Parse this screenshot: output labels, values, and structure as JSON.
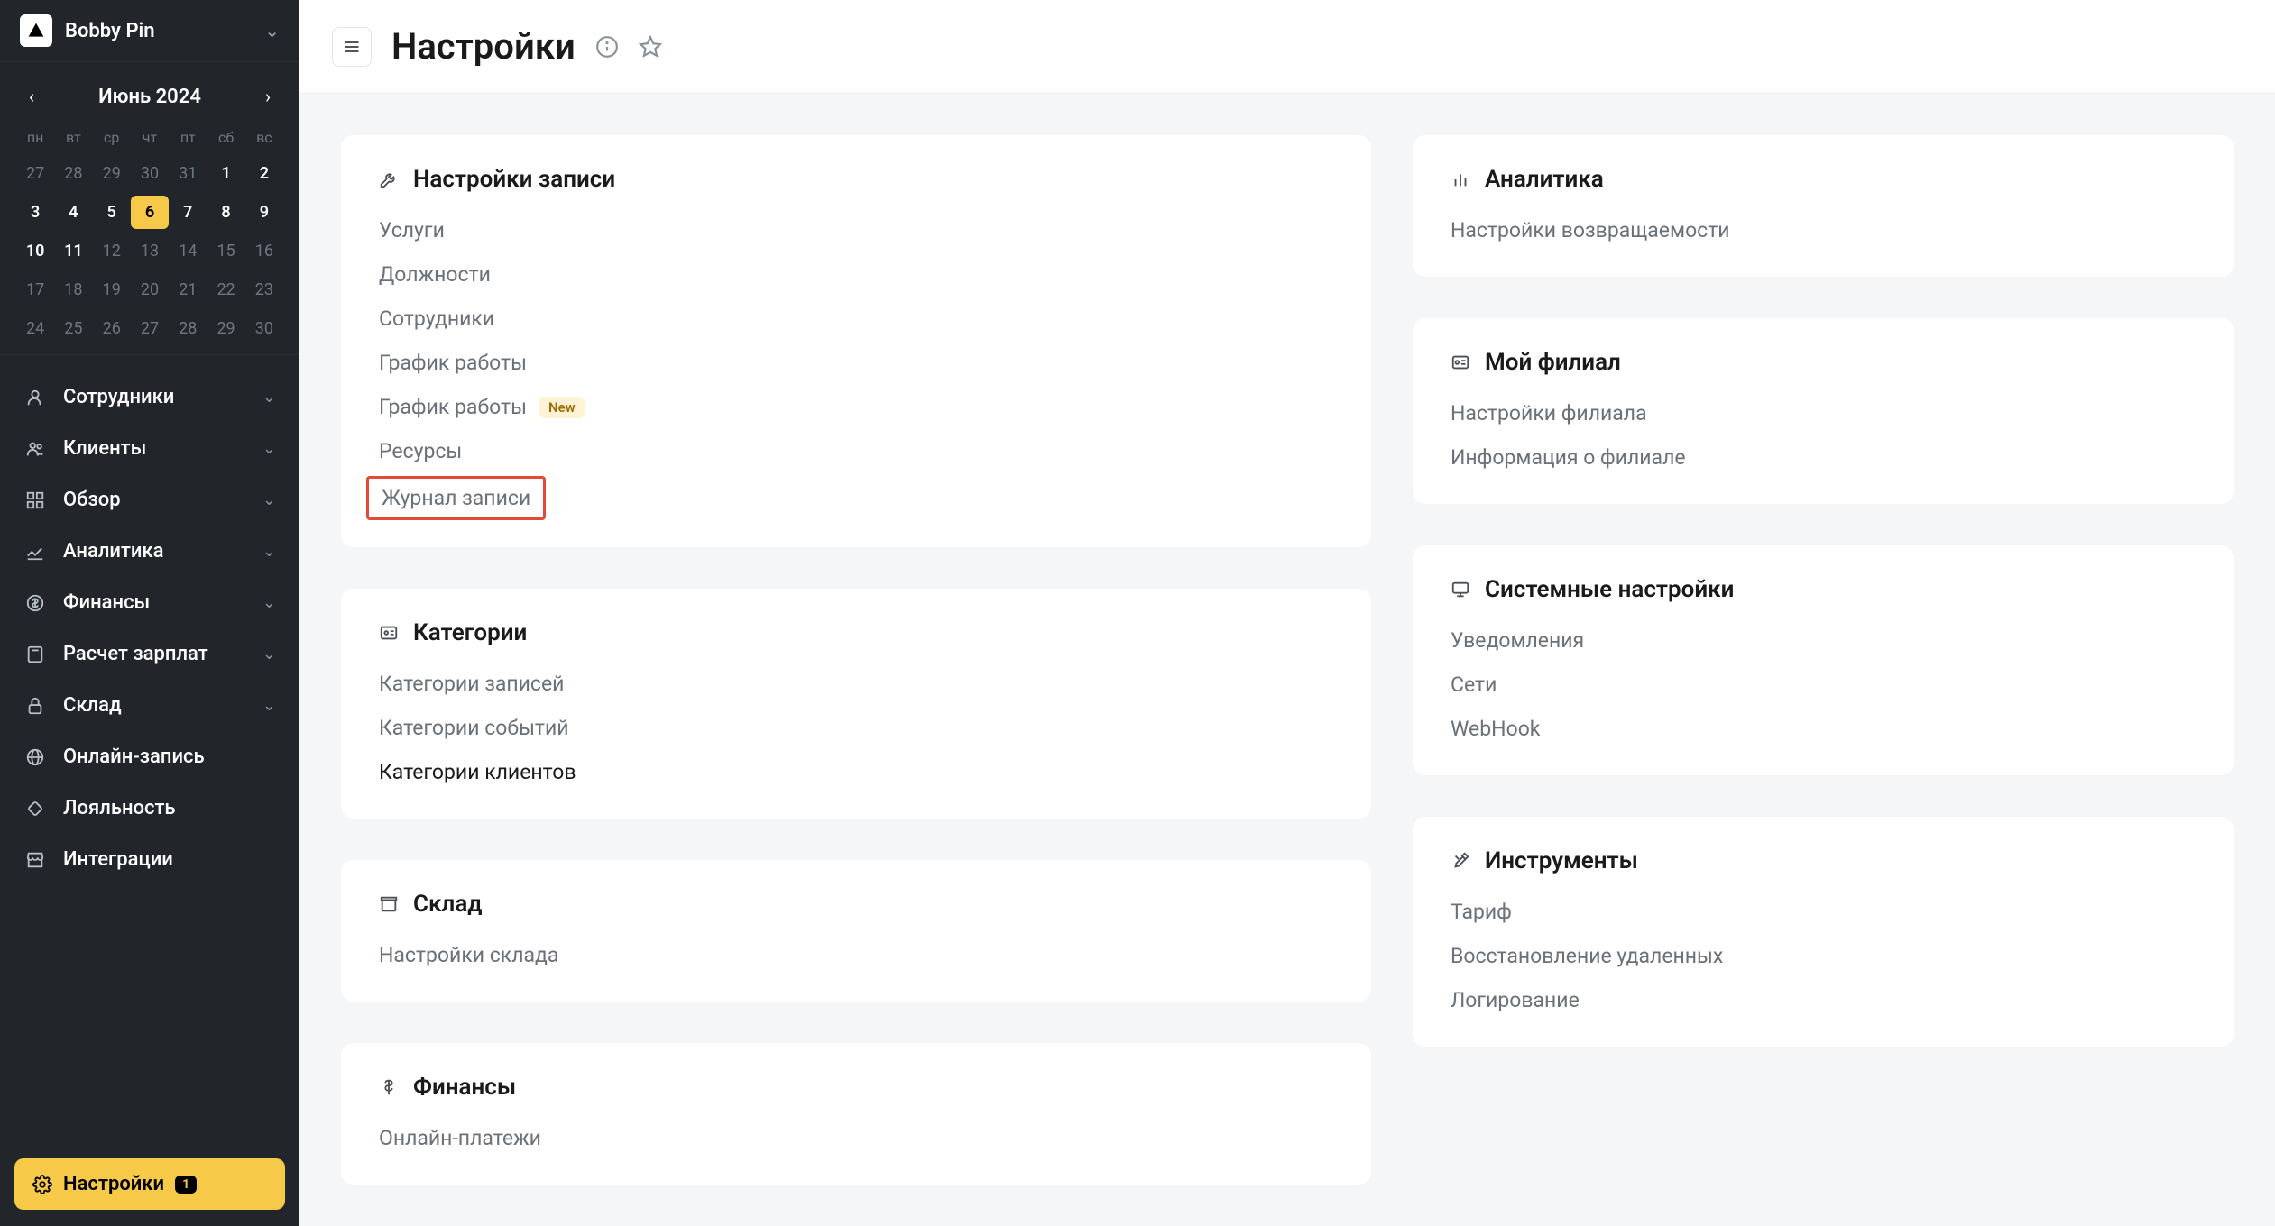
{
  "brand": "Bobby Pin",
  "calendar": {
    "title": "Июнь 2024",
    "dow": [
      "пн",
      "вт",
      "ср",
      "чт",
      "пт",
      "сб",
      "вс"
    ],
    "weeks": [
      [
        {
          "d": "27"
        },
        {
          "d": "28"
        },
        {
          "d": "29"
        },
        {
          "d": "30"
        },
        {
          "d": "31"
        },
        {
          "d": "1",
          "bold": true
        },
        {
          "d": "2",
          "bold": true
        }
      ],
      [
        {
          "d": "3",
          "bold": true
        },
        {
          "d": "4",
          "bold": true
        },
        {
          "d": "5",
          "bold": true
        },
        {
          "d": "6",
          "today": true
        },
        {
          "d": "7",
          "bold": true
        },
        {
          "d": "8",
          "bold": true
        },
        {
          "d": "9",
          "bold": true
        }
      ],
      [
        {
          "d": "10",
          "bold": true
        },
        {
          "d": "11",
          "bold": true
        },
        {
          "d": "12"
        },
        {
          "d": "13"
        },
        {
          "d": "14"
        },
        {
          "d": "15"
        },
        {
          "d": "16"
        }
      ],
      [
        {
          "d": "17"
        },
        {
          "d": "18"
        },
        {
          "d": "19"
        },
        {
          "d": "20"
        },
        {
          "d": "21"
        },
        {
          "d": "22"
        },
        {
          "d": "23"
        }
      ],
      [
        {
          "d": "24"
        },
        {
          "d": "25"
        },
        {
          "d": "26"
        },
        {
          "d": "27"
        },
        {
          "d": "28"
        },
        {
          "d": "29"
        },
        {
          "d": "30"
        }
      ]
    ]
  },
  "nav": [
    {
      "label": "Сотрудники",
      "expandable": true,
      "icon": "user"
    },
    {
      "label": "Клиенты",
      "expandable": true,
      "icon": "users"
    },
    {
      "label": "Обзор",
      "expandable": true,
      "icon": "grid"
    },
    {
      "label": "Аналитика",
      "expandable": true,
      "icon": "chart"
    },
    {
      "label": "Финансы",
      "expandable": true,
      "icon": "dollar"
    },
    {
      "label": "Расчет зарплат",
      "expandable": true,
      "icon": "calc"
    },
    {
      "label": "Склад",
      "expandable": true,
      "icon": "lock"
    },
    {
      "label": "Онлайн-запись",
      "expandable": false,
      "icon": "globe"
    },
    {
      "label": "Лояльность",
      "expandable": false,
      "icon": "diamond"
    },
    {
      "label": "Интеграции",
      "expandable": false,
      "icon": "shop"
    }
  ],
  "settings_btn": {
    "label": "Настройки",
    "badge": "1"
  },
  "page": {
    "title": "Настройки"
  },
  "cards_left": [
    {
      "icon": "wrench",
      "title": "Настройки записи",
      "links": [
        {
          "t": "Услуги"
        },
        {
          "t": "Должности"
        },
        {
          "t": "Сотрудники"
        },
        {
          "t": "График работы"
        },
        {
          "t": "График работы",
          "new": true
        },
        {
          "t": "Ресурсы"
        },
        {
          "t": "Журнал записи",
          "hl": true
        }
      ]
    },
    {
      "icon": "card",
      "title": "Категории",
      "links": [
        {
          "t": "Категории записей"
        },
        {
          "t": "Категории событий"
        },
        {
          "t": "Категории клиентов",
          "dark": true
        }
      ]
    },
    {
      "icon": "box",
      "title": "Склад",
      "links": [
        {
          "t": "Настройки склада"
        }
      ]
    },
    {
      "icon": "dollar",
      "title": "Финансы",
      "links": [
        {
          "t": "Онлайн-платежи"
        }
      ]
    }
  ],
  "cards_right": [
    {
      "icon": "bars",
      "title": "Аналитика",
      "links": [
        {
          "t": "Настройки возвращаемости"
        }
      ]
    },
    {
      "icon": "branch",
      "title": "Мой филиал",
      "links": [
        {
          "t": "Настройки филиала"
        },
        {
          "t": "Информация о филиале"
        }
      ]
    },
    {
      "icon": "monitor",
      "title": "Системные настройки",
      "links": [
        {
          "t": "Уведомления"
        },
        {
          "t": "Сети"
        },
        {
          "t": "WebHook"
        }
      ]
    },
    {
      "icon": "tools",
      "title": "Инструменты",
      "links": [
        {
          "t": "Тариф"
        },
        {
          "t": "Восстановление удаленных"
        },
        {
          "t": "Логирование"
        }
      ]
    }
  ]
}
